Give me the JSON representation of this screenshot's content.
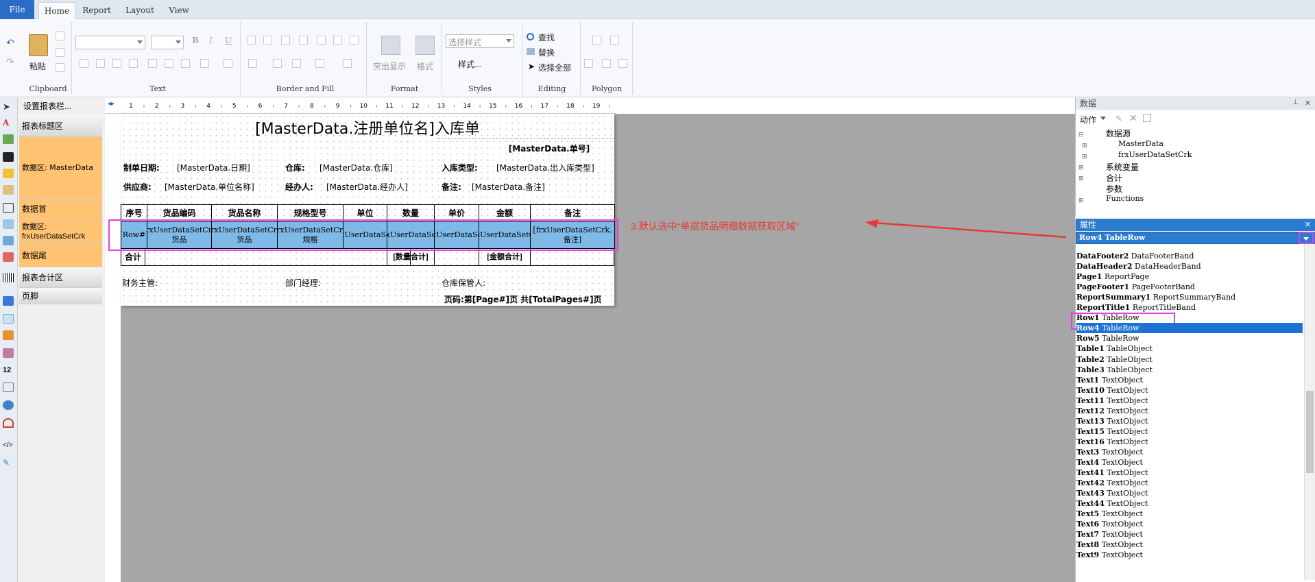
{
  "tabs": [
    "File",
    "Home",
    "Report",
    "Layout",
    "View"
  ],
  "ribbon": {
    "clipboard": {
      "paste": "粘贴",
      "label": "Clipboard"
    },
    "text_label": "Text",
    "border_label": "Border and Fill",
    "format": {
      "highlight": "突出显示",
      "format": "格式",
      "label": "Format"
    },
    "styles": {
      "select_placeholder": "选择样式",
      "styles_btn": "样式...",
      "label": "Styles"
    },
    "editing": {
      "find": "查找",
      "replace": "替换",
      "select_all": "选择全部",
      "label": "Editing"
    },
    "polygon_label": "Polygon"
  },
  "bands_header": "设置报表栏...",
  "bands": [
    {
      "label": "报表标题区"
    },
    {
      "label": "数据区: MasterData"
    },
    {
      "label": "数据首"
    },
    {
      "label": "数据区: frxUserDataSetCrk"
    },
    {
      "label": "数据尾"
    },
    {
      "label": "报表合计区"
    },
    {
      "label": "页脚"
    }
  ],
  "ruler_ticks": [
    "1",
    "2",
    "3",
    "4",
    "5",
    "6",
    "7",
    "8",
    "9",
    "10",
    "11",
    "12",
    "13",
    "14",
    "15",
    "16",
    "17",
    "18",
    "19"
  ],
  "report": {
    "title": "[MasterData.注册单位名]入库单",
    "doc_no": "[MasterData.单号]",
    "make_date_label": "制单日期:",
    "make_date": "[MasterData.日期]",
    "warehouse_label": "仓库:",
    "warehouse": "[MasterData.仓库]",
    "in_type_label": "入库类型:",
    "in_type": "[MasterData.出入库类型]",
    "supplier_label": "供应商:",
    "supplier": "[MasterData.单位名称]",
    "handler_label": "经办人:",
    "handler": "[MasterData.经办人]",
    "remark_label": "备注:",
    "remark": "[MasterData.备注]",
    "headers": [
      "序号",
      "货品编码",
      "货品名称",
      "规格型号",
      "单位",
      "数量",
      "单价",
      "金额",
      "备注"
    ],
    "row_cells": [
      "[Row#]",
      "[frxUserDataSetCrk.货品",
      "[frxUserDataSetCrk.货品",
      "[frxUserDataSetCrk.规格",
      "[frxUserDataSetC",
      "[frxUserDataSetC",
      "[frxUserDataSetC",
      "[frxUserDataSetCrk",
      "[frxUserDataSetCrk.备注]"
    ],
    "total_label": "合计",
    "total_qty": "[数量合计]",
    "total_amount": "[金额合计]",
    "finance": "财务主管:",
    "dept_mgr": "部门经理:",
    "keeper": "仓库保管人:",
    "page_no": "页码:第[Page#]页 共[TotalPages#]页"
  },
  "annotation": {
    "text": "3.默认选中“单据货品明细数据获取区域”",
    "color": "#e53935",
    "marker1": "1",
    "marker2": "2",
    "highlight_color": "#e040e0"
  },
  "data_panel": {
    "title": "数据",
    "action": "动作",
    "tree": [
      "数据源",
      "MasterData",
      "frxUserDataSetCrk",
      "系统变量",
      "合计",
      "参数",
      "Functions"
    ]
  },
  "prop_panel": {
    "title": "属性",
    "selected": "Row4 TableRow",
    "items": [
      [
        "DataFooter2",
        "DataFooterBand"
      ],
      [
        "DataHeader2",
        "DataHeaderBand"
      ],
      [
        "Page1",
        "ReportPage"
      ],
      [
        "PageFooter1",
        "PageFooterBand"
      ],
      [
        "ReportSummary1",
        "ReportSummaryBand"
      ],
      [
        "ReportTitle1",
        "ReportTitleBand"
      ],
      [
        "Row1",
        "TableRow"
      ],
      [
        "Row4",
        "TableRow"
      ],
      [
        "Row5",
        "TableRow"
      ],
      [
        "Table1",
        "TableObject"
      ],
      [
        "Table2",
        "TableObject"
      ],
      [
        "Table3",
        "TableObject"
      ],
      [
        "Text1",
        "TextObject"
      ],
      [
        "Text10",
        "TextObject"
      ],
      [
        "Text11",
        "TextObject"
      ],
      [
        "Text12",
        "TextObject"
      ],
      [
        "Text13",
        "TextObject"
      ],
      [
        "Text15",
        "TextObject"
      ],
      [
        "Text16",
        "TextObject"
      ],
      [
        "Text3",
        "TextObject"
      ],
      [
        "Text4",
        "TextObject"
      ],
      [
        "Text41",
        "TextObject"
      ],
      [
        "Text42",
        "TextObject"
      ],
      [
        "Text43",
        "TextObject"
      ],
      [
        "Text44",
        "TextObject"
      ],
      [
        "Text5",
        "TextObject"
      ],
      [
        "Text6",
        "TextObject"
      ],
      [
        "Text7",
        "TextObject"
      ],
      [
        "Text8",
        "TextObject"
      ],
      [
        "Text9",
        "TextObject"
      ]
    ]
  }
}
